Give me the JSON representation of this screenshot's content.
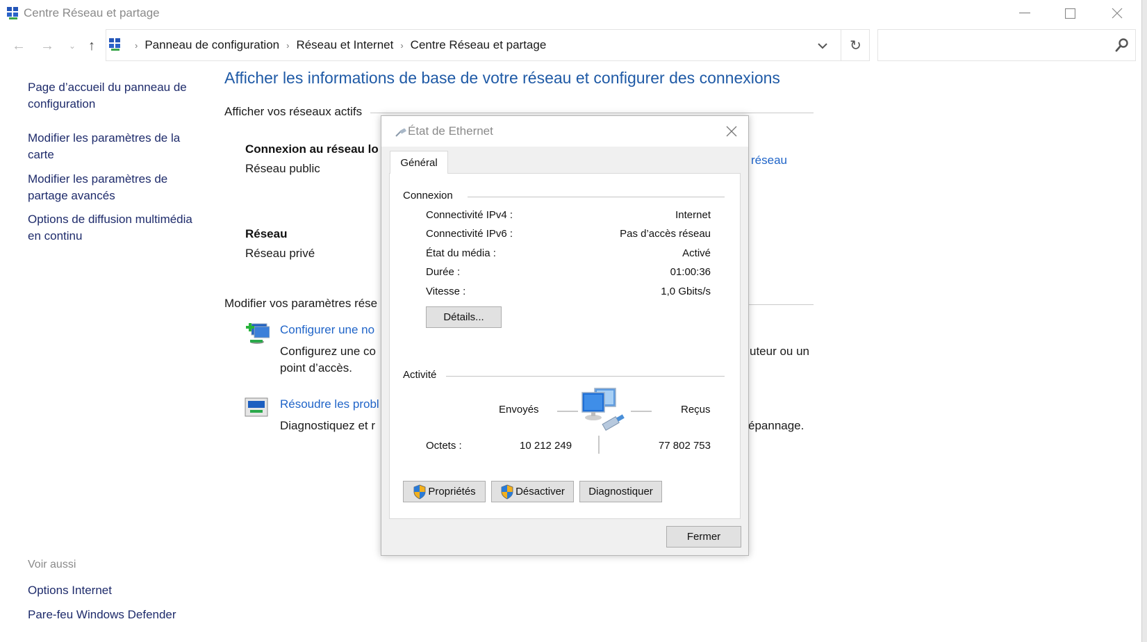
{
  "window": {
    "title": "Centre Réseau et partage",
    "controls": {
      "minimize": "—",
      "maximize": "☐",
      "close": "✕"
    }
  },
  "nav": {
    "back_icon": "←",
    "forward_icon": "→",
    "recent_icon": "⌄",
    "up_icon": "↑",
    "breadcrumb": [
      "Panneau de configuration",
      "Réseau et Internet",
      "Centre Réseau et partage"
    ],
    "breadcrumb_sep": "›",
    "dropdown_icon": "⌄",
    "refresh_icon": "↻",
    "search_placeholder": "",
    "search_value": ""
  },
  "sidebar": {
    "links": [
      "Page d’accueil du panneau de configuration",
      "Modifier les paramètres de la carte",
      "Modifier les paramètres de partage avancés",
      "Options de diffusion multimédia en continu"
    ],
    "see_also_label": "Voir aussi",
    "see_also_links": [
      "Options Internet",
      "Pare-feu Windows Defender"
    ]
  },
  "main": {
    "title": "Afficher les informations de base de votre réseau et configurer des connexions",
    "active_networks_heading": "Afficher vos réseaux actifs",
    "networks": [
      {
        "name": "Connexion au réseau lo",
        "type": "Réseau public",
        "link_fragment": "réseau"
      },
      {
        "name": "Réseau",
        "type": "Réseau privé"
      }
    ],
    "change_settings_heading": "Modifier vos paramètres rése",
    "tasks": [
      {
        "link": "Configurer une no",
        "desc_line1": "Configurez une co",
        "desc_line1_tail": "uteur ou un",
        "desc_line2": "point d’accès."
      },
      {
        "link": "Résoudre les probl",
        "desc_line1": "Diagnostiquez et r",
        "desc_line1_tail": "épannage."
      }
    ]
  },
  "dialog": {
    "title": "État de Ethernet",
    "tab": "Général",
    "connection_group": "Connexion",
    "connection_rows": [
      {
        "label": "Connectivité IPv4 :",
        "value": "Internet"
      },
      {
        "label": "Connectivité IPv6 :",
        "value": "Pas d’accès réseau"
      },
      {
        "label": "État du média :",
        "value": "Activé"
      },
      {
        "label": "Durée :",
        "value": "01:00:36"
      },
      {
        "label": "Vitesse :",
        "value": "1,0 Gbits/s"
      }
    ],
    "details_button": "Détails...",
    "activity_group": "Activité",
    "sent_label": "Envoyés",
    "received_label": "Reçus",
    "bytes_label": "Octets :",
    "bytes_sent": "10 212 249",
    "bytes_received": "77 802 753",
    "properties_button": "Propriétés",
    "disable_button": "Désactiver",
    "diagnose_button": "Diagnostiquer",
    "close_button": "Fermer"
  },
  "colors": {
    "link_blue": "#1f64c8",
    "title_blue": "#1f5aa6",
    "sidebar_link": "#1e2b6b",
    "shield_blue": "#2b7bd6",
    "shield_yellow": "#f2b01e"
  }
}
